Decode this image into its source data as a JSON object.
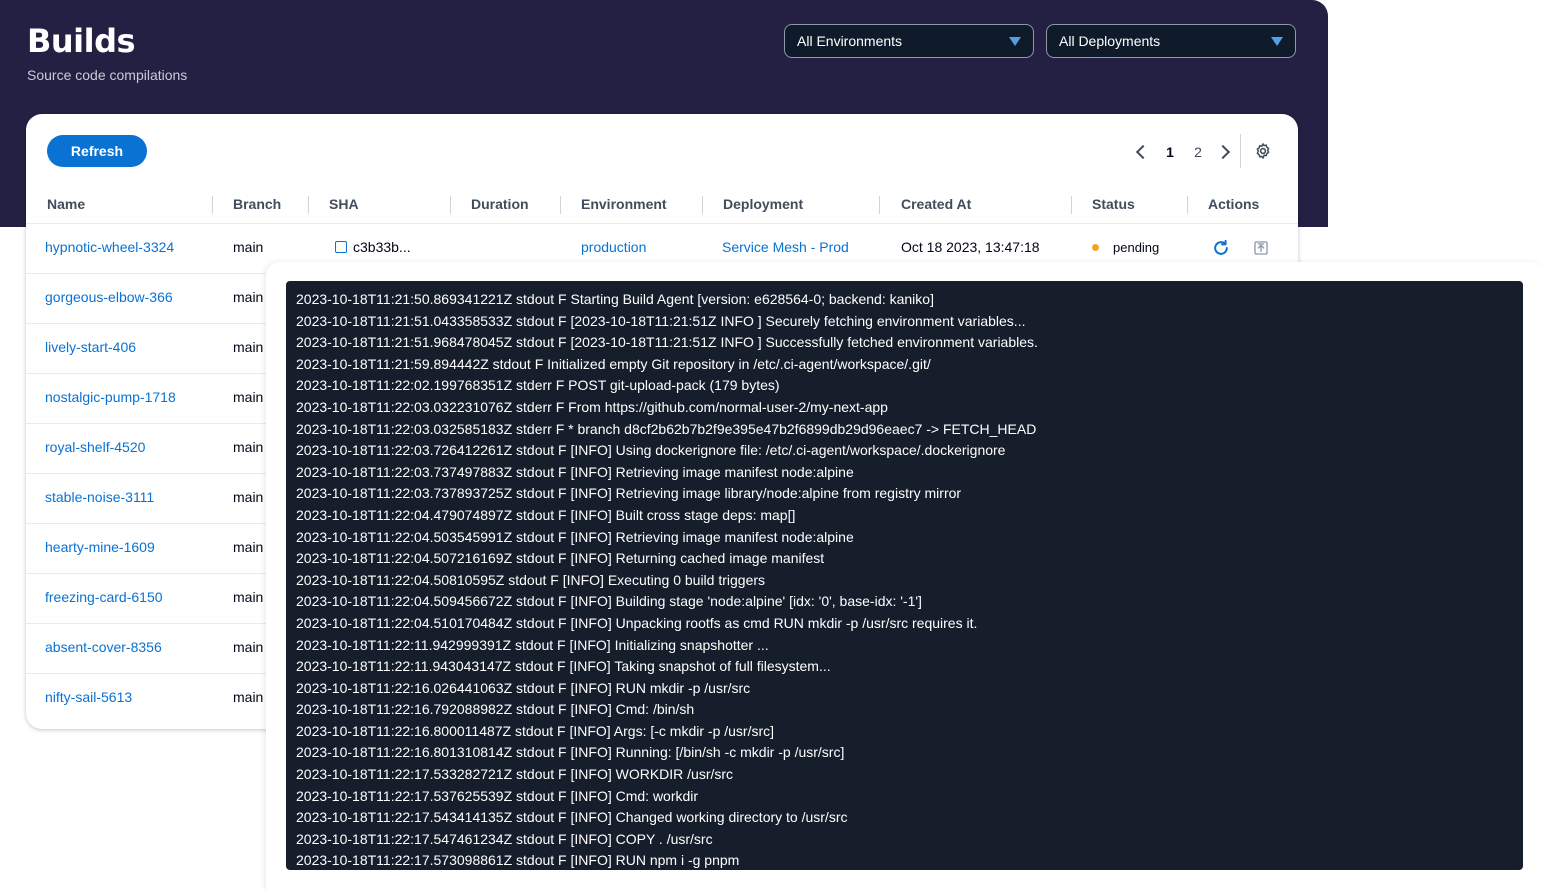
{
  "header": {
    "title": "Builds",
    "subtitle": "Source code compilations"
  },
  "filters": {
    "environments": "All Environments",
    "deployments": "All Deployments"
  },
  "toolbar": {
    "refresh_label": "Refresh"
  },
  "pagination": {
    "pages": [
      "1",
      "2"
    ],
    "current": "1"
  },
  "table": {
    "columns": [
      "Name",
      "Branch",
      "SHA",
      "Duration",
      "Environment",
      "Deployment",
      "Created At",
      "Status",
      "Actions"
    ],
    "rows": [
      {
        "name": "hypnotic-wheel-3324",
        "branch": "main",
        "sha": "c3b33b...",
        "duration": "",
        "environment": "production",
        "deployment": "Service Mesh - Prod",
        "created_at": "Oct 18 2023, 13:47:18",
        "status": "pending"
      },
      {
        "name": "gorgeous-elbow-366",
        "branch": "main"
      },
      {
        "name": "lively-start-406",
        "branch": "main"
      },
      {
        "name": "nostalgic-pump-1718",
        "branch": "main"
      },
      {
        "name": "royal-shelf-4520",
        "branch": "main"
      },
      {
        "name": "stable-noise-3111",
        "branch": "main"
      },
      {
        "name": "hearty-mine-1609",
        "branch": "main"
      },
      {
        "name": "freezing-card-6150",
        "branch": "main"
      },
      {
        "name": "absent-cover-8356",
        "branch": "main"
      },
      {
        "name": "nifty-sail-5613",
        "branch": "main"
      }
    ]
  },
  "colors": {
    "hero_bg": "#232043",
    "primary": "#0972d3",
    "log_bg": "#161d2b",
    "pending": "#f5a524"
  },
  "logs": [
    "2023-10-18T11:21:50.869341221Z stdout F Starting Build Agent [version: e628564-0; backend: kaniko]",
    "2023-10-18T11:21:51.043358533Z stdout F [2023-10-18T11:21:51Z INFO ] Securely fetching environment variables...",
    "2023-10-18T11:21:51.968478045Z stdout F [2023-10-18T11:21:51Z INFO ] Successfully fetched environment variables.",
    "2023-10-18T11:21:59.894442Z stdout F Initialized empty Git repository in /etc/.ci-agent/workspace/.git/",
    "2023-10-18T11:22:02.199768351Z stderr F POST git-upload-pack (179 bytes)",
    "2023-10-18T11:22:03.032231076Z stderr F From https://github.com/normal-user-2/my-next-app",
    "2023-10-18T11:22:03.032585183Z stderr F * branch d8cf2b62b7b2f9e395e47b2f6899db29d96eaec7 -> FETCH_HEAD",
    "2023-10-18T11:22:03.726412261Z stdout F [INFO] Using dockerignore file: /etc/.ci-agent/workspace/.dockerignore",
    "2023-10-18T11:22:03.737497883Z stdout F [INFO] Retrieving image manifest node:alpine",
    "2023-10-18T11:22:03.737893725Z stdout F [INFO] Retrieving image library/node:alpine from registry mirror",
    "2023-10-18T11:22:04.479074897Z stdout F [INFO] Built cross stage deps: map[]",
    "2023-10-18T11:22:04.503545991Z stdout F [INFO] Retrieving image manifest node:alpine",
    "2023-10-18T11:22:04.507216169Z stdout F [INFO] Returning cached image manifest",
    "2023-10-18T11:22:04.50810595Z stdout F [INFO] Executing 0 build triggers",
    "2023-10-18T11:22:04.509456672Z stdout F [INFO] Building stage 'node:alpine' [idx: '0', base-idx: '-1']",
    "2023-10-18T11:22:04.510170484Z stdout F [INFO] Unpacking rootfs as cmd RUN mkdir -p /usr/src requires it.",
    "2023-10-18T11:22:11.942999391Z stdout F [INFO] Initializing snapshotter ...",
    "2023-10-18T11:22:11.943043147Z stdout F [INFO] Taking snapshot of full filesystem...",
    "2023-10-18T11:22:16.026441063Z stdout F [INFO] RUN mkdir -p /usr/src",
    "2023-10-18T11:22:16.792088982Z stdout F [INFO] Cmd: /bin/sh",
    "2023-10-18T11:22:16.800011487Z stdout F [INFO] Args: [-c mkdir -p /usr/src]",
    "2023-10-18T11:22:16.801310814Z stdout F [INFO] Running: [/bin/sh -c mkdir -p /usr/src]",
    "2023-10-18T11:22:17.533282721Z stdout F [INFO] WORKDIR /usr/src",
    "2023-10-18T11:22:17.537625539Z stdout F [INFO] Cmd: workdir",
    "2023-10-18T11:22:17.543414135Z stdout F [INFO] Changed working directory to /usr/src",
    "2023-10-18T11:22:17.547461234Z stdout F [INFO] COPY . /usr/src",
    "2023-10-18T11:22:17.573098861Z stdout F [INFO] RUN npm i -g pnpm"
  ]
}
